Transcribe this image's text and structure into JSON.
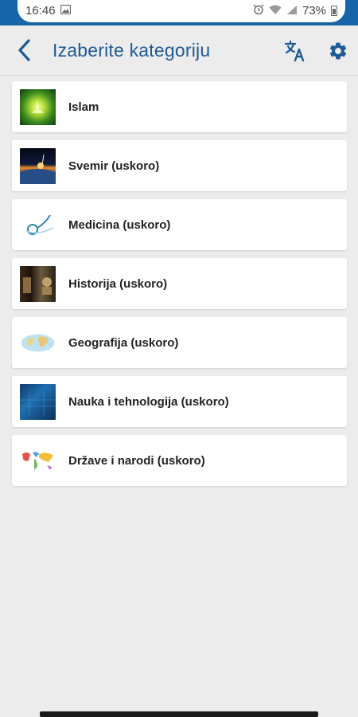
{
  "status_bar": {
    "time": "16:46",
    "battery": "73%",
    "accent_color": "#1565a8"
  },
  "app_bar": {
    "title": "Izaberite kategoriju",
    "back_icon": "back-arrow-icon",
    "translate_icon": "translate-icon",
    "settings_icon": "gear-icon",
    "title_color": "#1e5a95"
  },
  "categories": [
    {
      "label": "Islam"
    },
    {
      "label": "Svemir (uskoro)"
    },
    {
      "label": "Medicina (uskoro)"
    },
    {
      "label": "Historija (uskoro)"
    },
    {
      "label": "Geografija (uskoro)"
    },
    {
      "label": "Nauka i tehnologija (uskoro)"
    },
    {
      "label": "Države i narodi (uskoro)"
    }
  ]
}
